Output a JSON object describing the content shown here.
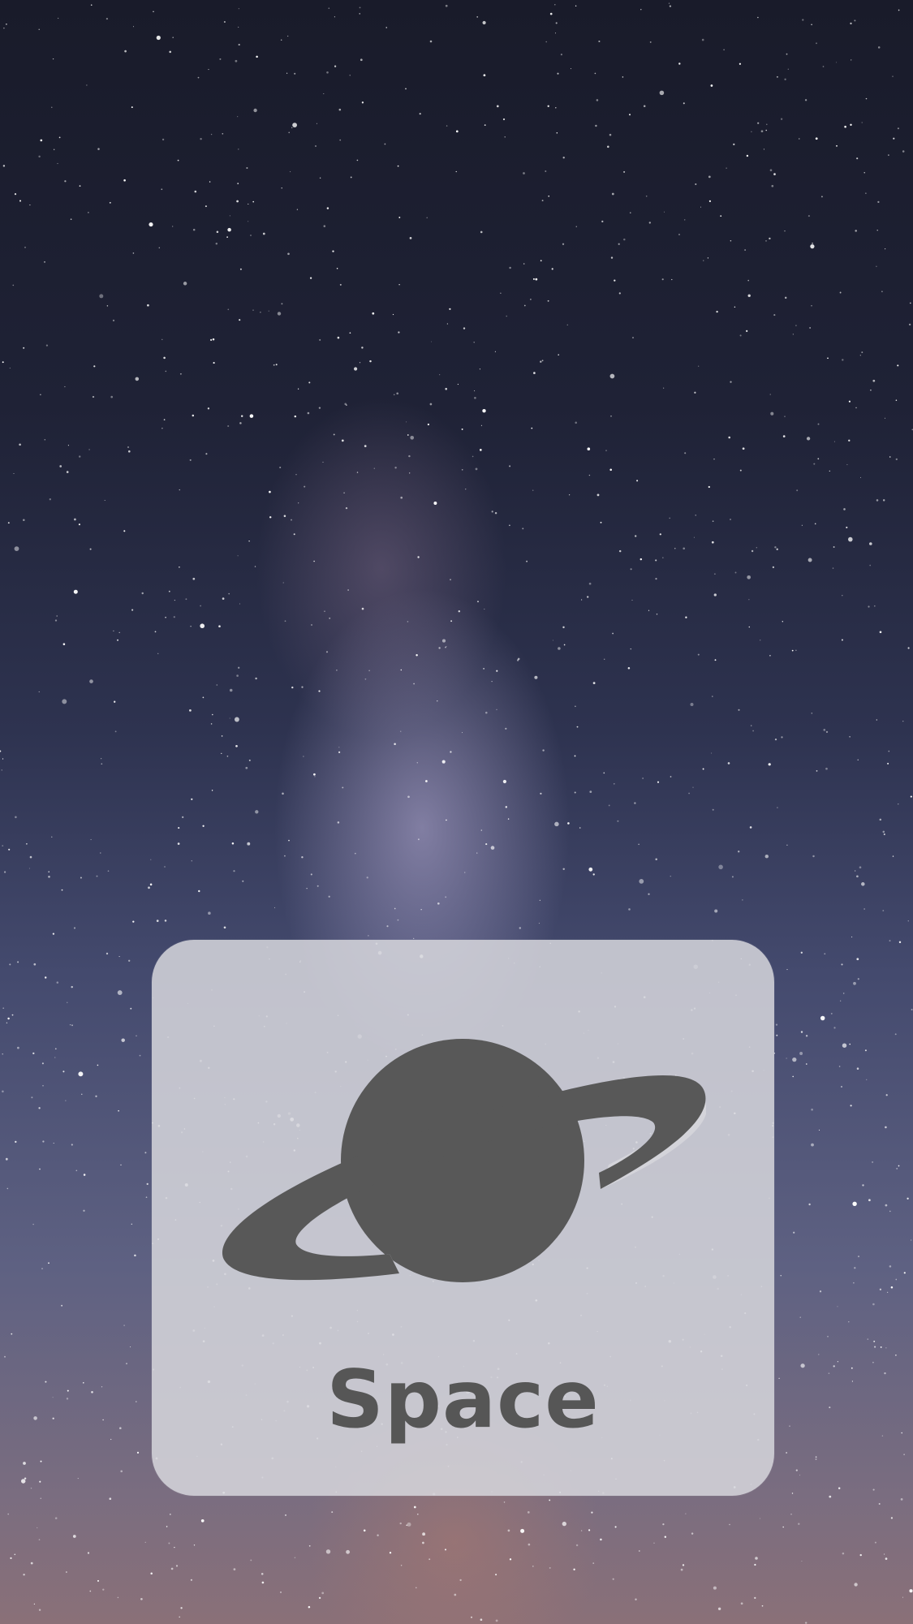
{
  "app_tile": {
    "label": "Space",
    "icon": "planet-saturn-icon",
    "icon_color": "#585858",
    "tile_color": "#d6d6dc"
  },
  "wallpaper": {
    "description_colors": [
      "#191b2a",
      "#444a6e",
      "#8a7078"
    ]
  }
}
